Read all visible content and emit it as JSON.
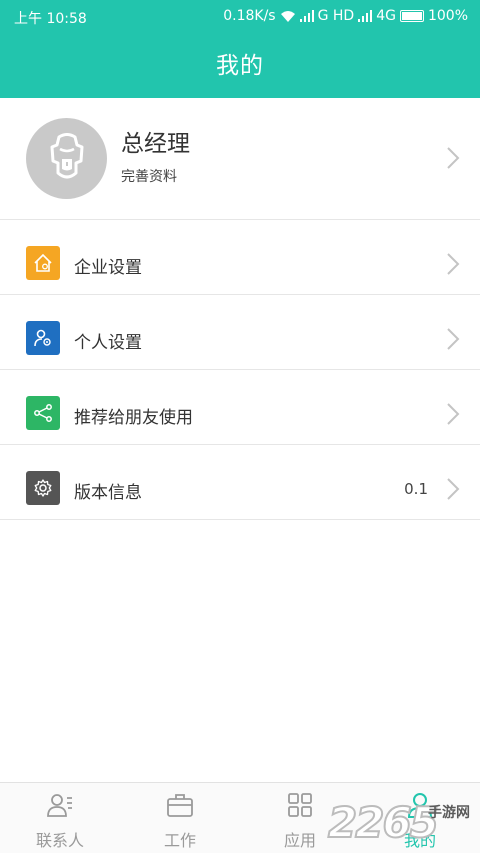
{
  "status_bar": {
    "time": "上午 10:58",
    "network_speed": "0.18K/s",
    "signal_info": "G HD",
    "network_type": "4G",
    "battery": "100%"
  },
  "header": {
    "title": "我的"
  },
  "profile": {
    "name": "总经理",
    "subtitle": "完善资料"
  },
  "menu": {
    "items": [
      {
        "label": "企业设置",
        "icon": "home-gear-icon",
        "color": "#f5a623"
      },
      {
        "label": "个人设置",
        "icon": "user-gear-icon",
        "color": "#1f6fc1"
      },
      {
        "label": "推荐给朋友使用",
        "icon": "share-icon",
        "color": "#2db665"
      },
      {
        "label": "版本信息",
        "icon": "gear-icon",
        "color": "#555555",
        "value": "0.1"
      }
    ]
  },
  "tabbar": {
    "tabs": [
      {
        "label": "联系人",
        "icon": "contacts-icon"
      },
      {
        "label": "工作",
        "icon": "briefcase-icon"
      },
      {
        "label": "应用",
        "icon": "apps-grid-icon"
      },
      {
        "label": "我的",
        "icon": "person-icon",
        "active": true
      }
    ]
  },
  "watermark": {
    "number": "2265",
    "text": "手游网"
  },
  "colors": {
    "accent": "#22c5ad",
    "divider": "#e6e6e6",
    "inactive_tab": "#9a9a9a"
  }
}
